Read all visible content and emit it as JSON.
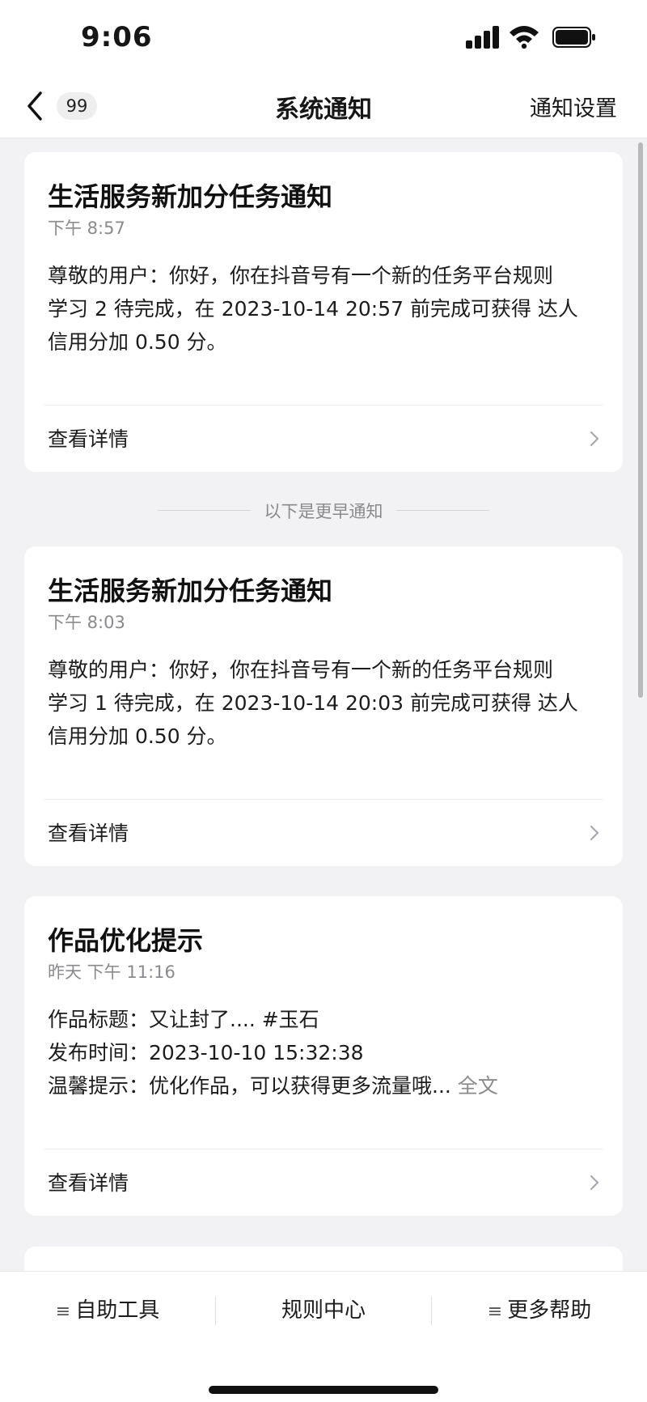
{
  "status_bar": {
    "time": "9:06"
  },
  "nav": {
    "badge": "99",
    "title": "系统通知",
    "action": "通知设置"
  },
  "notifications": [
    {
      "title": "生活服务新加分任务通知",
      "time": "下午 8:57",
      "body": [
        "尊敬的用户：你好，你在抖音号有一个新的任务平台规则",
        "学习 2 待完成，在 2023-10-14 20:57 前完成可获得 达人",
        "信用分加 0.50 分。"
      ],
      "details_label": "查看详情"
    },
    {
      "title": "生活服务新加分任务通知",
      "time": "下午 8:03",
      "body": [
        "尊敬的用户：你好，你在抖音号有一个新的任务平台规则",
        "学习 1 待完成，在 2023-10-14 20:03 前完成可获得 达人",
        "信用分加 0.50 分。"
      ],
      "details_label": "查看详情"
    },
    {
      "title": "作品优化提示",
      "time": "昨天 下午 11:16",
      "body": [
        "作品标题：又让封了.... #玉石",
        "发布时间：2023-10-10 15:32:38",
        "温馨提示：优化作品，可以获得更多流量哦..."
      ],
      "full_text_link": "全文",
      "details_label": "查看详情"
    }
  ],
  "separator_text": "以下是更早通知",
  "toolbar": {
    "items": [
      {
        "label": "自助工具",
        "menu_icon": true
      },
      {
        "label": "规则中心",
        "menu_icon": false
      },
      {
        "label": "更多帮助",
        "menu_icon": true
      }
    ]
  },
  "icons": {
    "back": "chevron-left-icon",
    "chevron": "chevron-right-icon",
    "menu": "menu-lines-icon",
    "signal": "cellular-signal-icon",
    "wifi": "wifi-icon",
    "battery": "battery-icon"
  }
}
